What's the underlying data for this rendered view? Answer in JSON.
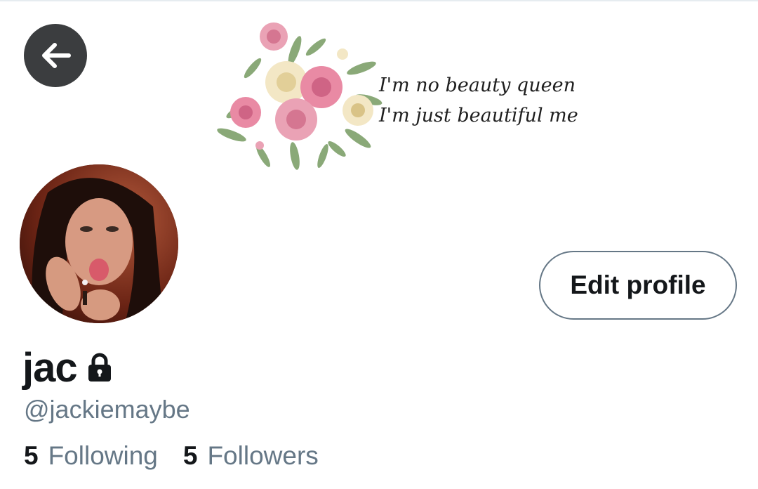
{
  "header": {
    "back_icon": "arrow-left-icon"
  },
  "banner": {
    "line1": "I'm no beauty queen",
    "line2": "I'm just beautiful me",
    "rose_colors": [
      "#e98aa4",
      "#f3e7c5",
      "#d9a36a"
    ]
  },
  "profile": {
    "display_name": "jac",
    "protected_icon": "lock-icon",
    "handle": "@jackiemaybe",
    "edit_label": "Edit profile"
  },
  "stats": {
    "following_count": "5",
    "following_label": "Following",
    "followers_count": "5",
    "followers_label": "Followers"
  }
}
